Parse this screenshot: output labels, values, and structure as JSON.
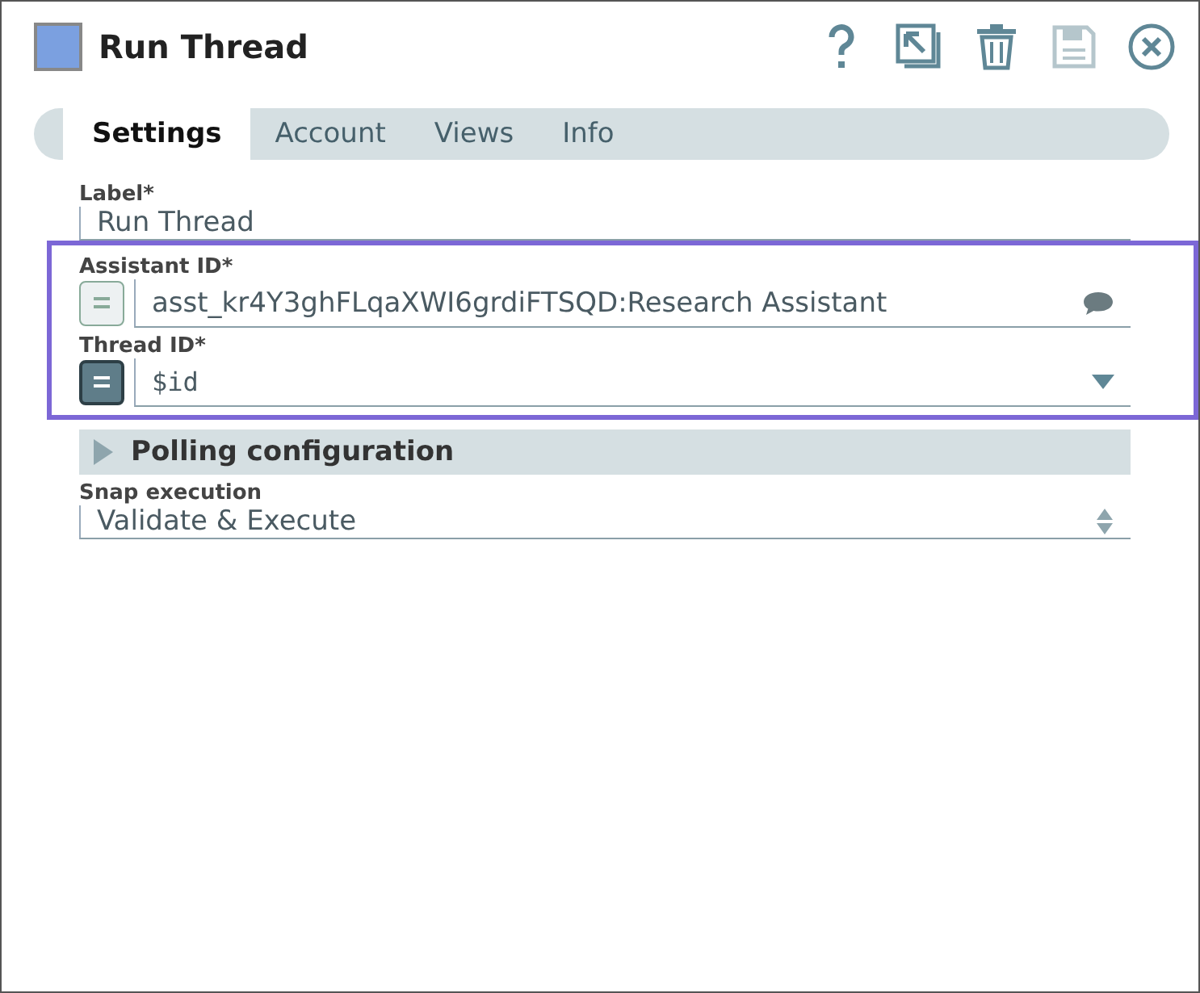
{
  "window": {
    "title": "Run Thread"
  },
  "tabs": [
    {
      "label": "Settings",
      "selected": true
    },
    {
      "label": "Account",
      "selected": false
    },
    {
      "label": "Views",
      "selected": false
    },
    {
      "label": "Info",
      "selected": false
    }
  ],
  "fields": [
    {
      "kind": "text",
      "label": "Label*",
      "value": "Run Thread"
    }
  ],
  "highlighted_fields": [
    {
      "kind": "suggest",
      "label": "Assistant ID*",
      "value": "asst_kr4Y3ghFLqaXWI6grdiFTSQD:Research Assistant",
      "expression": false
    },
    {
      "kind": "dropdown",
      "label": "Thread ID*",
      "value": "$id",
      "expression": true
    }
  ],
  "more_fields": [
    {
      "kind": "section",
      "label": "Polling configuration",
      "expanded": false
    },
    {
      "kind": "select",
      "label": "Snap execution",
      "value": "Validate & Execute"
    }
  ]
}
